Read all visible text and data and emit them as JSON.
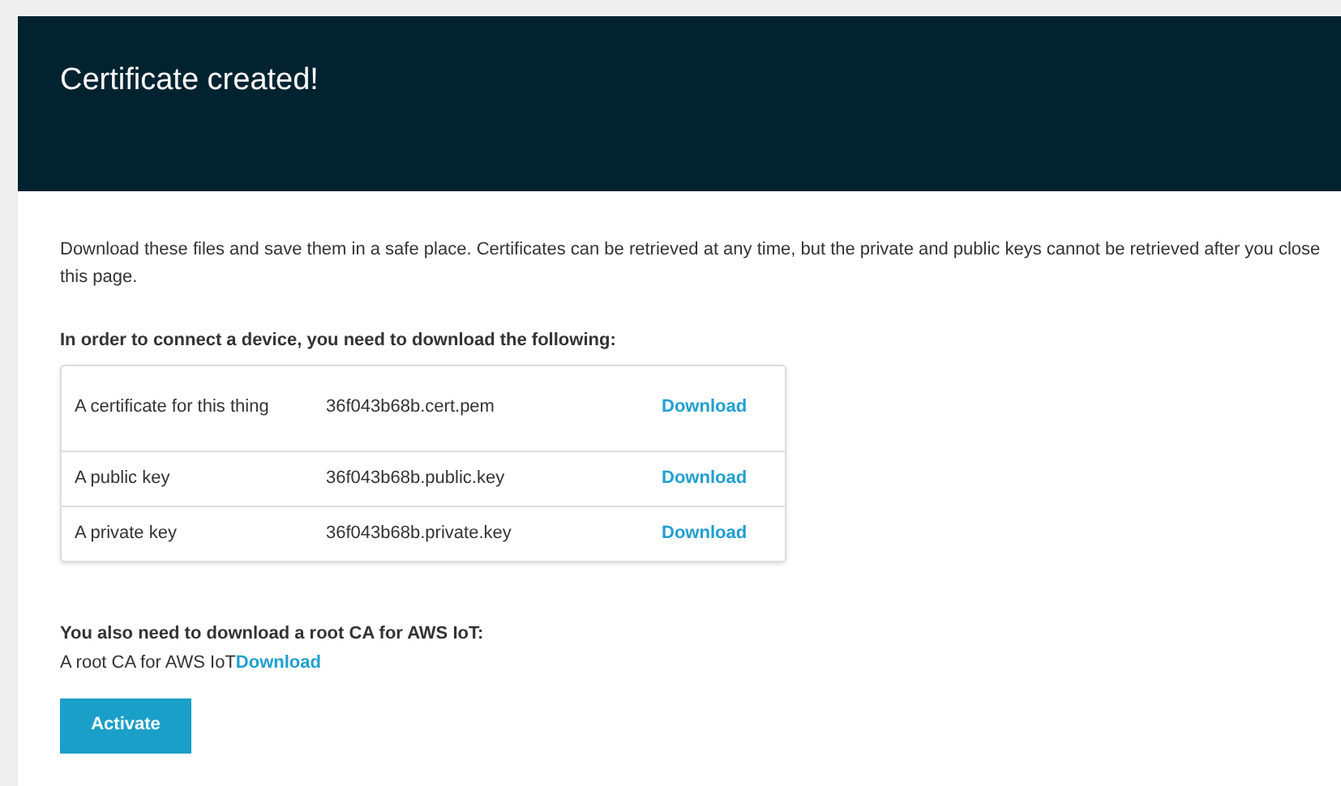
{
  "header": {
    "title": "Certificate created!"
  },
  "intro": "Download these files and save them in a safe place. Certificates can be retrieved at any time, but the private and public keys cannot be retrieved after you close this page.",
  "files_heading": "In order to connect a device, you need to download the following:",
  "files": [
    {
      "item": "A certificate for this thing",
      "file": "36f043b68b.cert.pem",
      "action": "Download"
    },
    {
      "item": "A public key",
      "file": "36f043b68b.public.key",
      "action": "Download"
    },
    {
      "item": "A private key",
      "file": "36f043b68b.private.key",
      "action": "Download"
    }
  ],
  "root_ca": {
    "heading": "You also need to download a root CA for AWS IoT:",
    "label": "A root CA for AWS IoT",
    "action": "Download"
  },
  "buttons": [
    "Activate"
  ]
}
